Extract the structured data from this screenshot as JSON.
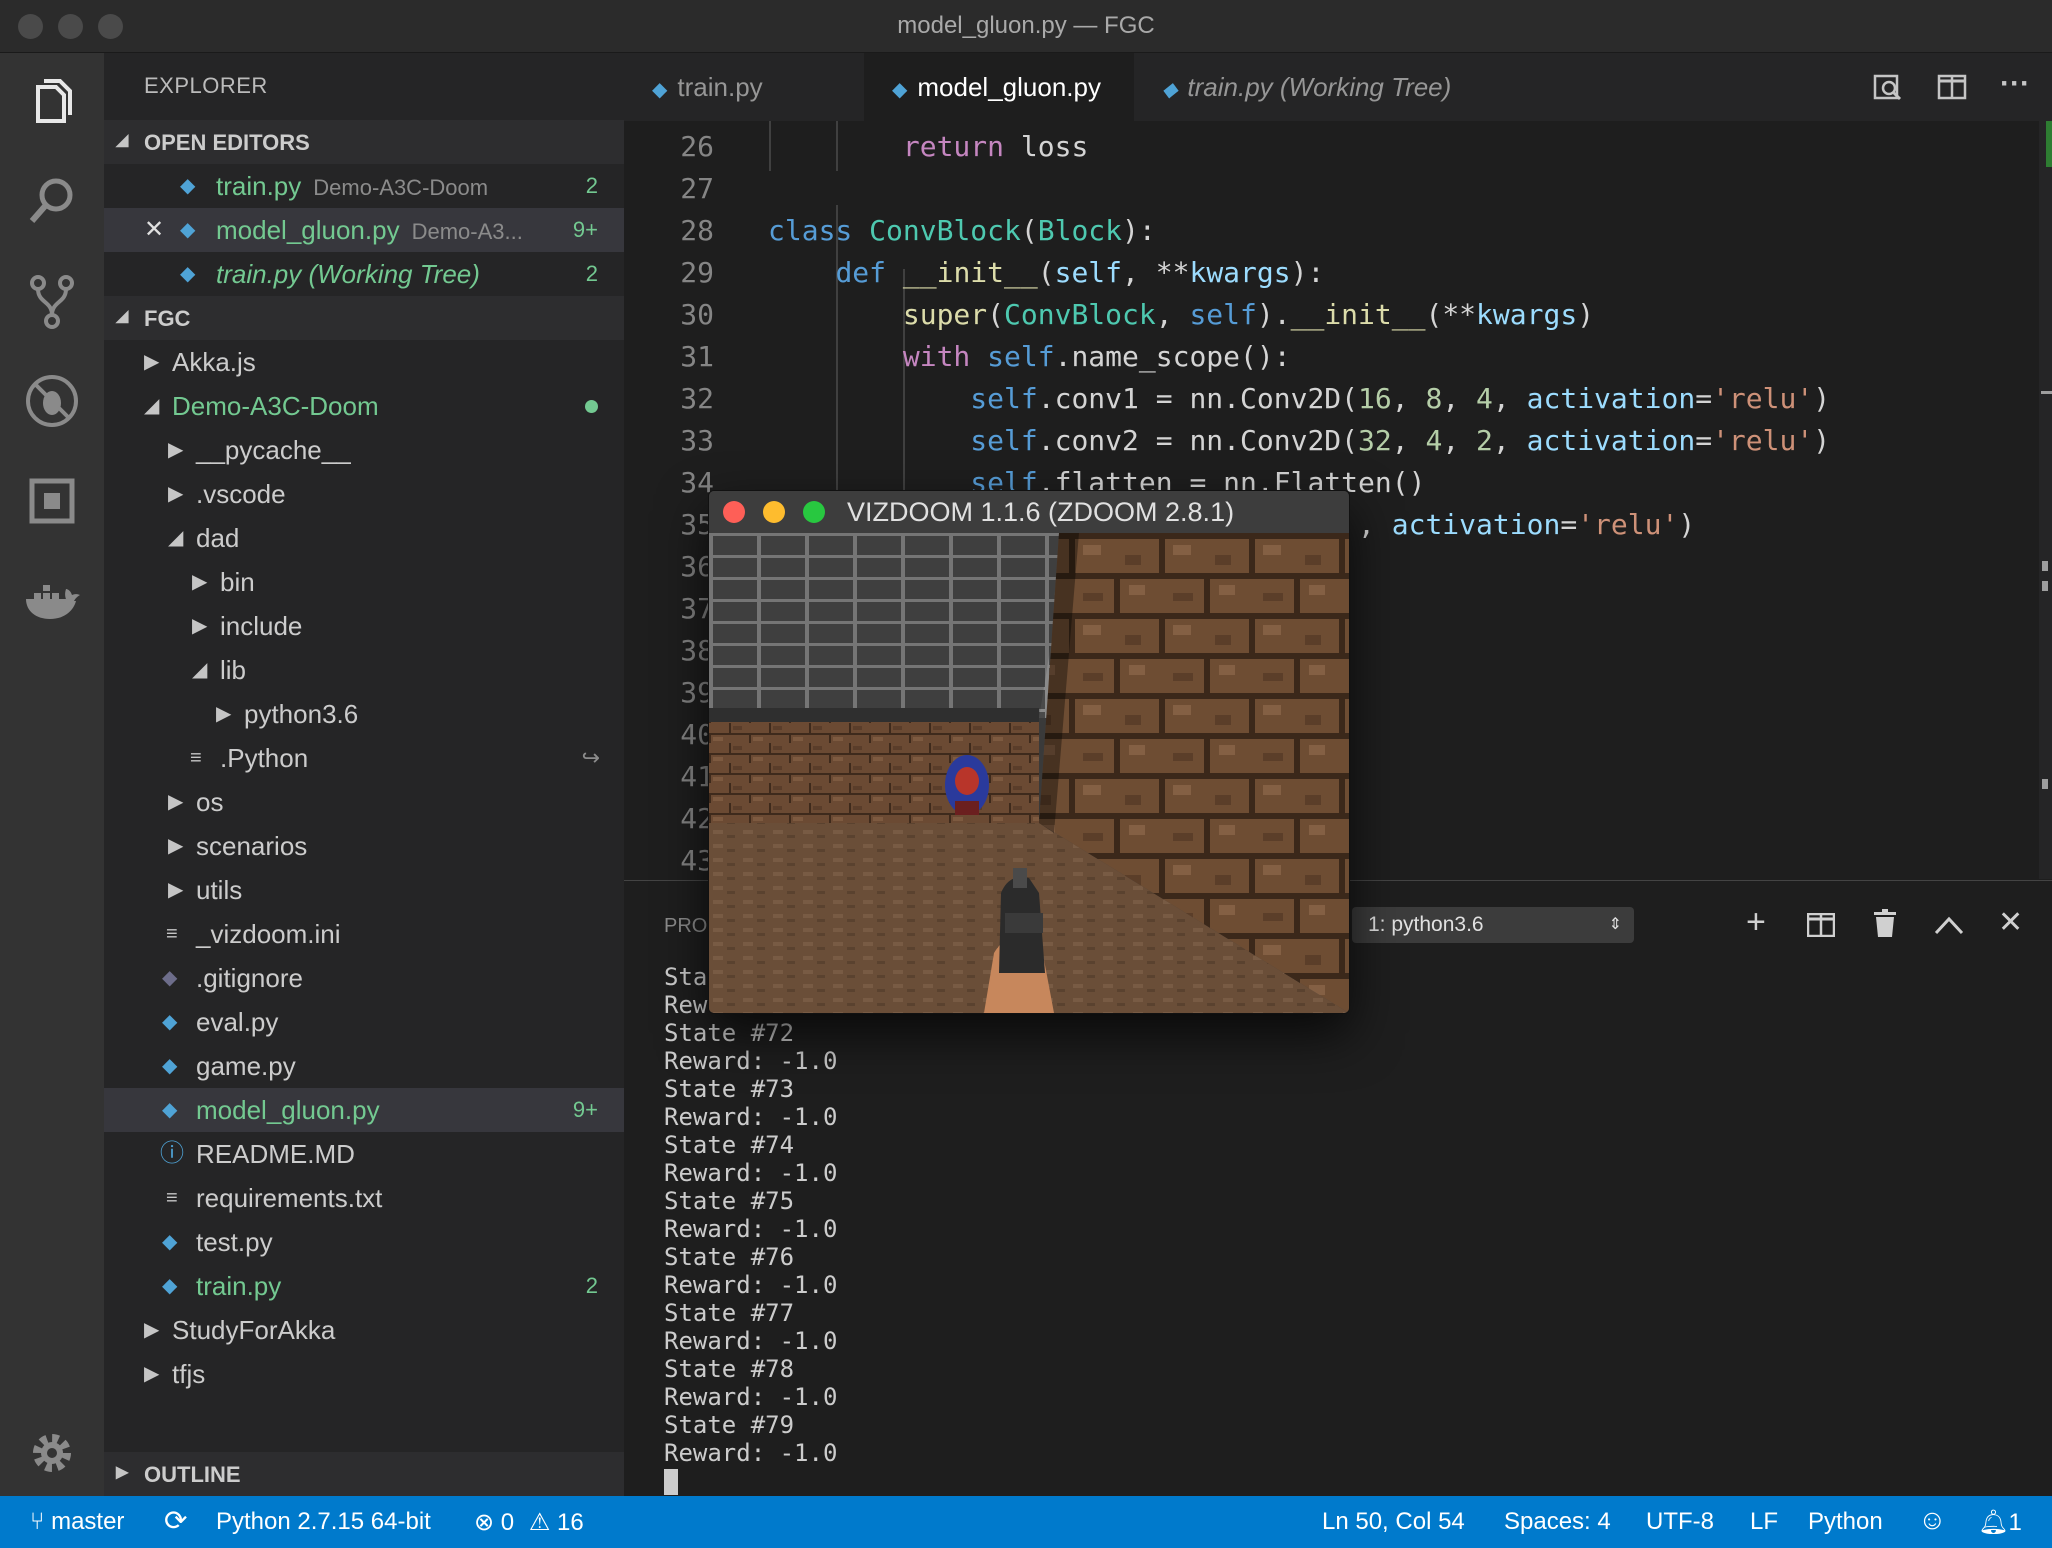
{
  "window": {
    "title": "model_gluon.py — FGC"
  },
  "activity": {
    "items": [
      "files-icon",
      "search-icon",
      "source-control-icon",
      "debug-icon",
      "extensions-icon",
      "docker-icon",
      "settings-gear-icon"
    ]
  },
  "sidebar": {
    "title": "EXPLORER",
    "open_editors": {
      "label": "OPEN EDITORS",
      "items": [
        {
          "name": "train.py",
          "desc": "Demo-A3C-Doom",
          "badge": "2"
        },
        {
          "name": "model_gluon.py",
          "desc": "Demo-A3...",
          "badge": "9+"
        },
        {
          "name": "train.py (Working Tree)",
          "desc": "",
          "badge": "2"
        }
      ]
    },
    "workspace": {
      "label": "FGC",
      "tree": [
        {
          "name": "Akka.js"
        },
        {
          "name": "Demo-A3C-Doom"
        },
        {
          "name": "__pycache__"
        },
        {
          "name": ".vscode"
        },
        {
          "name": "dad"
        },
        {
          "name": "bin"
        },
        {
          "name": "include"
        },
        {
          "name": "lib"
        },
        {
          "name": "python3.6"
        },
        {
          "name": ".Python"
        },
        {
          "name": "os"
        },
        {
          "name": "scenarios"
        },
        {
          "name": "utils"
        },
        {
          "name": "_vizdoom.ini"
        },
        {
          "name": ".gitignore"
        },
        {
          "name": "eval.py"
        },
        {
          "name": "game.py"
        },
        {
          "name": "model_gluon.py",
          "badge": "9+"
        },
        {
          "name": "README.MD"
        },
        {
          "name": "requirements.txt"
        },
        {
          "name": "test.py"
        },
        {
          "name": "train.py",
          "badge": "2"
        },
        {
          "name": "StudyForAkka"
        },
        {
          "name": "tfjs"
        }
      ]
    },
    "outline_label": "OUTLINE"
  },
  "tabs": [
    {
      "label": "train.py"
    },
    {
      "label": "model_gluon.py"
    },
    {
      "label": "train.py (Working Tree)"
    }
  ],
  "editor": {
    "line_numbers": [
      "26",
      "27",
      "28",
      "29",
      "30",
      "31",
      "32",
      "33",
      "34",
      "35",
      "36",
      "37",
      "38",
      "39",
      "40",
      "41",
      "42",
      "43"
    ]
  },
  "panel": {
    "tab_label": "PRO",
    "terminal_select": "1: python3.6",
    "terminal_lines": [
      "Sta",
      "Rew",
      "State #72",
      "Reward: -1.0",
      "State #73",
      "Reward: -1.0",
      "State #74",
      "Reward: -1.0",
      "State #75",
      "Reward: -1.0",
      "State #76",
      "Reward: -1.0",
      "State #77",
      "Reward: -1.0",
      "State #78",
      "Reward: -1.0",
      "State #79",
      "Reward: -1.0"
    ]
  },
  "vizdoom": {
    "title": "VIZDOOM 1.1.6 (ZDOOM 2.8.1)"
  },
  "statusbar": {
    "branch": "master",
    "interpreter": "Python 2.7.15 64-bit",
    "errors": "0",
    "warnings": "16",
    "position": "Ln 50, Col 54",
    "spaces": "Spaces: 4",
    "encoding": "UTF-8",
    "eol": "LF",
    "language": "Python",
    "notifications": "1"
  },
  "colors": {
    "statusbar": "#007acc",
    "git_modified": "#73c991",
    "python_icon": "#4fa3d6"
  }
}
